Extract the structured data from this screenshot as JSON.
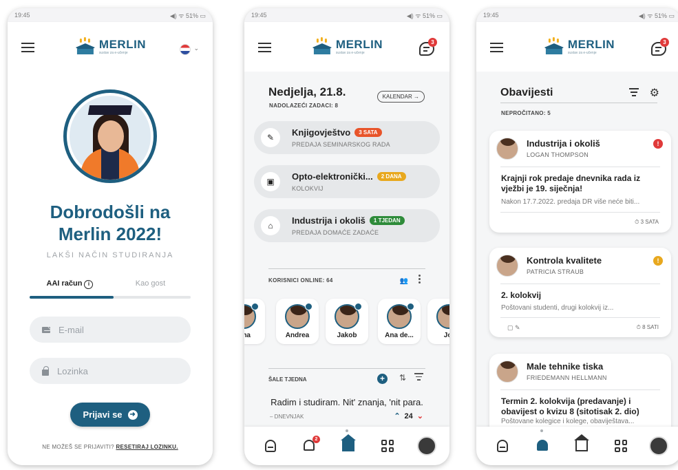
{
  "status": {
    "time": "19:45",
    "icons": "◀) ᯤ 51% ▭"
  },
  "brand": {
    "name": "MERLIN",
    "sub": "sustav za e-učenje",
    "notification_count": "3"
  },
  "login": {
    "welcome_line1": "Dobrodošli na",
    "welcome_line2": "Merlin 2022!",
    "tagline": "LAKŠI NAČIN STUDIRANJA",
    "tab_aai": "AAI račun",
    "tab_guest": "Kao gost",
    "email_placeholder": "E-mail",
    "password_placeholder": "Lozinka",
    "login_button": "Prijavi se",
    "forgot_text": "NE MOŽEŠ SE PRIJAVITI?",
    "reset_link": "RESETIRAJ LOZINKU."
  },
  "home": {
    "date": "Nedjelja, 21.8.",
    "upcoming": "NADOLAZEĆI ZADACI: 8",
    "calendar_button": "KALENDAR →",
    "tasks": [
      {
        "title": "Knjigovještvo",
        "chip": "3 SATA",
        "chip_color": "#e8542a",
        "sub": "PREDAJA SEMINARSKOG RADA",
        "icon": "✎"
      },
      {
        "title": "Opto-elektronički...",
        "chip": "2 DANA",
        "chip_color": "#e8a81e",
        "sub": "KOLOKVIJ",
        "icon": "▣"
      },
      {
        "title": "Industrija i okoliš",
        "chip": "1 TJEDAN",
        "chip_color": "#2e8b3a",
        "sub": "PREDAJA DOMAĆE ZADAĆE",
        "icon": "⌂"
      }
    ],
    "online_label": "KORISNICI ONLINE: 64",
    "users": [
      "lana",
      "Andrea",
      "Jakob",
      "Ana de...",
      "Jol"
    ],
    "quote_label": "ŠALE TJEDNA",
    "quote_text": "Radim i studiram. Nit' znanja, 'nit para.",
    "quote_source": "– DNEVNJAK",
    "vote_count": "24",
    "bell_badge": "2"
  },
  "notifications": {
    "title": "Obavijesti",
    "unread": "NEPROČITANO: 5",
    "items": [
      {
        "course": "Industrija i okoliš",
        "author": "LOGAN THOMPSON",
        "flag": "!",
        "flag_color": "#e03a3a",
        "headline": "Krajnji rok predaje dnevnika rada iz vježbi je 19. siječnja!",
        "body": "Nakon 17.7.2022. predaja DR više neće biti...",
        "time": "⏱ 3 SATA",
        "attach": ""
      },
      {
        "course": "Kontrola kvalitete",
        "author": "PATRICIA STRAUB",
        "flag": "!",
        "flag_color": "#e8a81e",
        "headline": "2. kolokvij",
        "body": "Poštovani studenti, drugi kolokvij iz...",
        "time": "⏱ 8 SATI",
        "attach": "▢ ✎"
      },
      {
        "course": "Male tehnike tiska",
        "author": "FRIEDEMANN HELLMANN",
        "flag": "",
        "flag_color": "",
        "headline": "Termin 2. kolokvija (predavanje) i obavijest o kvizu 8 (sitotisak 2. dio)",
        "body": "Poštovane kolegice i kolege, obaviještava...",
        "time": "",
        "attach": ""
      }
    ]
  }
}
